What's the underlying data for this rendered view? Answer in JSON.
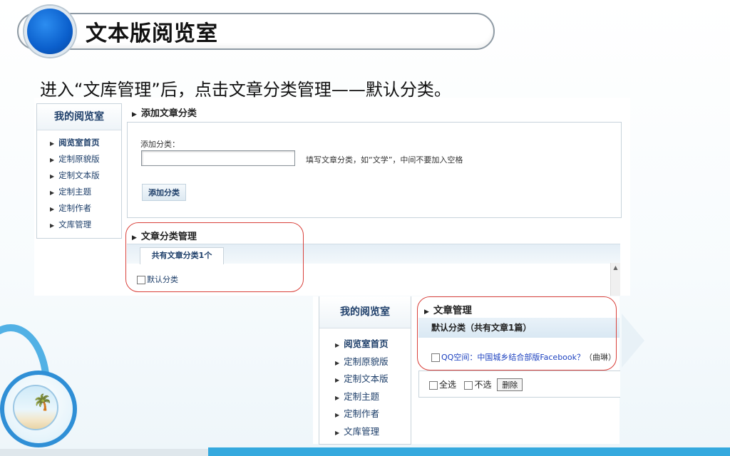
{
  "title": "文本版阅览室",
  "instruction": "进入“文库管理”后，点击文章分类管理——默认分类。",
  "shot1": {
    "sidebar": {
      "heading": "我的阅览室",
      "items": [
        "阅览室首页",
        "定制原貌版",
        "定制文本版",
        "定制主题",
        "定制作者",
        "文库管理"
      ]
    },
    "add_section": {
      "heading": "添加文章分类",
      "field_label": "添加分类：",
      "input_value": "",
      "hint": "填写文章分类，如“文学”，中间不要加入空格",
      "button": "添加分类"
    },
    "manage_section": {
      "heading": "文章分类管理",
      "tab": "共有文章分类1个",
      "categories": [
        "默认分类"
      ]
    }
  },
  "shot2": {
    "sidebar": {
      "heading": "我的阅览室",
      "items": [
        "阅览室首页",
        "定制原貌版",
        "定制文本版",
        "定制主题",
        "定制作者",
        "文库管理"
      ]
    },
    "heading": "文章管理",
    "category_bar": "默认分类（共有文章1篇）",
    "article_title": "QQ空间：中国城乡结合部版Facebook？",
    "article_author": "（曲琳）",
    "select_all": "全选",
    "select_none": "不选",
    "delete_button": "删除"
  },
  "colors": {
    "accent": "#35a9de",
    "highlight_oval": "#d9413b",
    "link": "#1a3fbf"
  }
}
